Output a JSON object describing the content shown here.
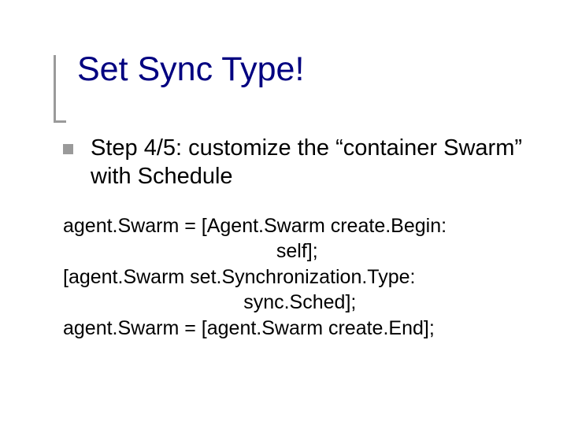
{
  "title": "Set Sync Type!",
  "step_text": "Step 4/5: customize the “container Swarm” with Schedule",
  "code": {
    "l1": "agent.Swarm = [Agent.Swarm create.Begin:",
    "l2": "                                       self];",
    "l3": "[agent.Swarm set.Synchronization.Type:",
    "l4": "                                 sync.Sched];",
    "l5": "agent.Swarm = [agent.Swarm create.End];"
  }
}
